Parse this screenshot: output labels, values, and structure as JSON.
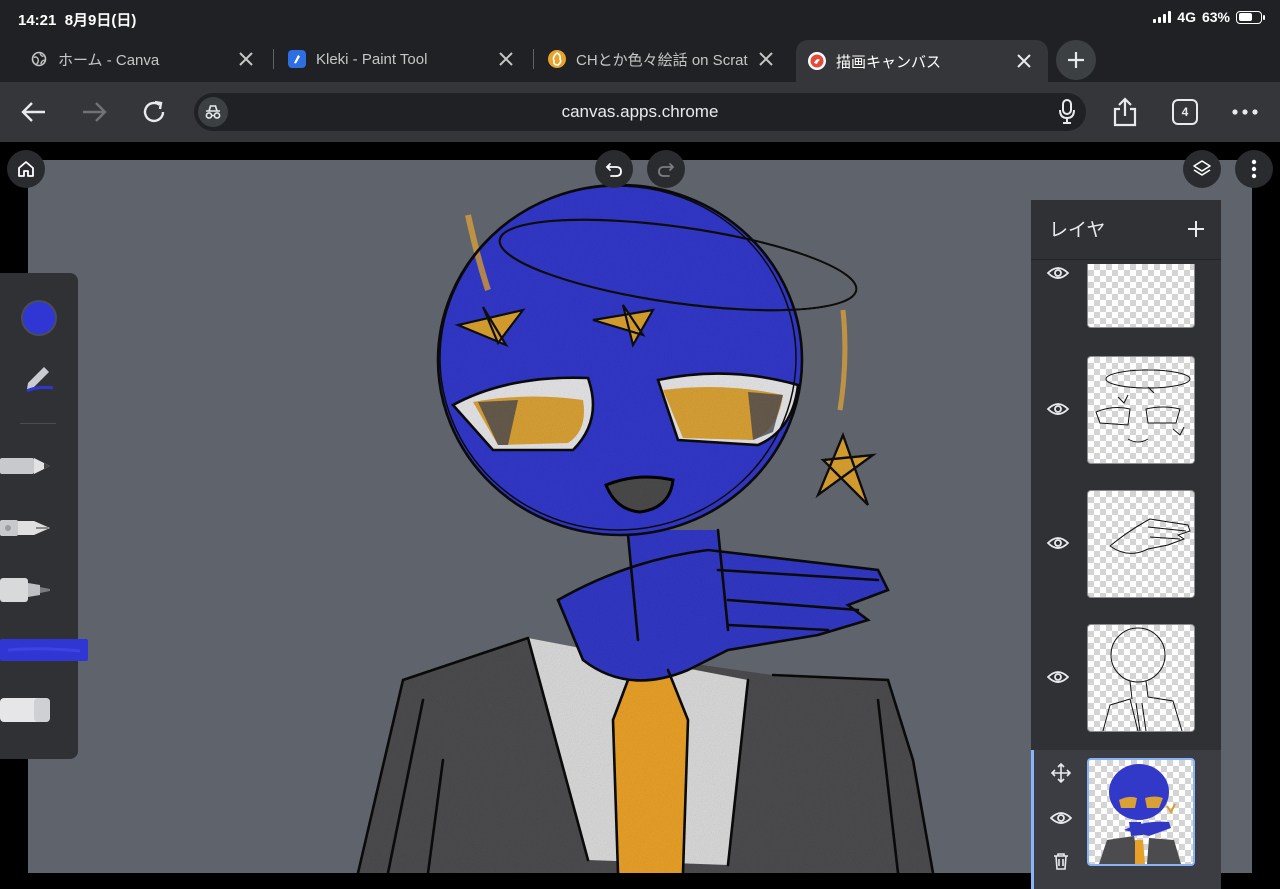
{
  "status_bar": {
    "time": "14:21",
    "date": "8月9日(日)",
    "network": "4G",
    "battery_percent": "63%",
    "battery_level": 0.63
  },
  "tabs": [
    {
      "title": "ホーム - Canva",
      "favicon": "globe-icon",
      "active": false
    },
    {
      "title": "Kleki - Paint Tool",
      "favicon": "kleki-icon",
      "active": false
    },
    {
      "title": "CHとか色々絵話 on Scrat",
      "favicon": "scratch-icon",
      "active": false
    },
    {
      "title": "描画キャンバス",
      "favicon": "canvas-app-icon",
      "active": true
    }
  ],
  "toolbar": {
    "url": "canvas.apps.chrome",
    "tab_count": "4"
  },
  "canvas": {
    "background_color": "#5f636c"
  },
  "tools": {
    "current_color": "#2f36d3",
    "items": [
      "pencil",
      "fountain-pen",
      "marker",
      "crayon",
      "eraser"
    ],
    "selected": "crayon"
  },
  "layers": {
    "title": "レイヤ",
    "items": [
      {
        "name": "layer-empty",
        "visible": true,
        "selected": false
      },
      {
        "name": "layer-face-lines",
        "visible": true,
        "selected": false
      },
      {
        "name": "layer-hand-lines",
        "visible": true,
        "selected": false
      },
      {
        "name": "layer-body-lines",
        "visible": true,
        "selected": false
      },
      {
        "name": "layer-color",
        "visible": true,
        "selected": true
      }
    ]
  },
  "colors": {
    "accent": "#8ab4f8",
    "skin_blue": "#2f36c8",
    "accent_yellow": "#e8a82a",
    "suit": "#4a4a4a"
  }
}
